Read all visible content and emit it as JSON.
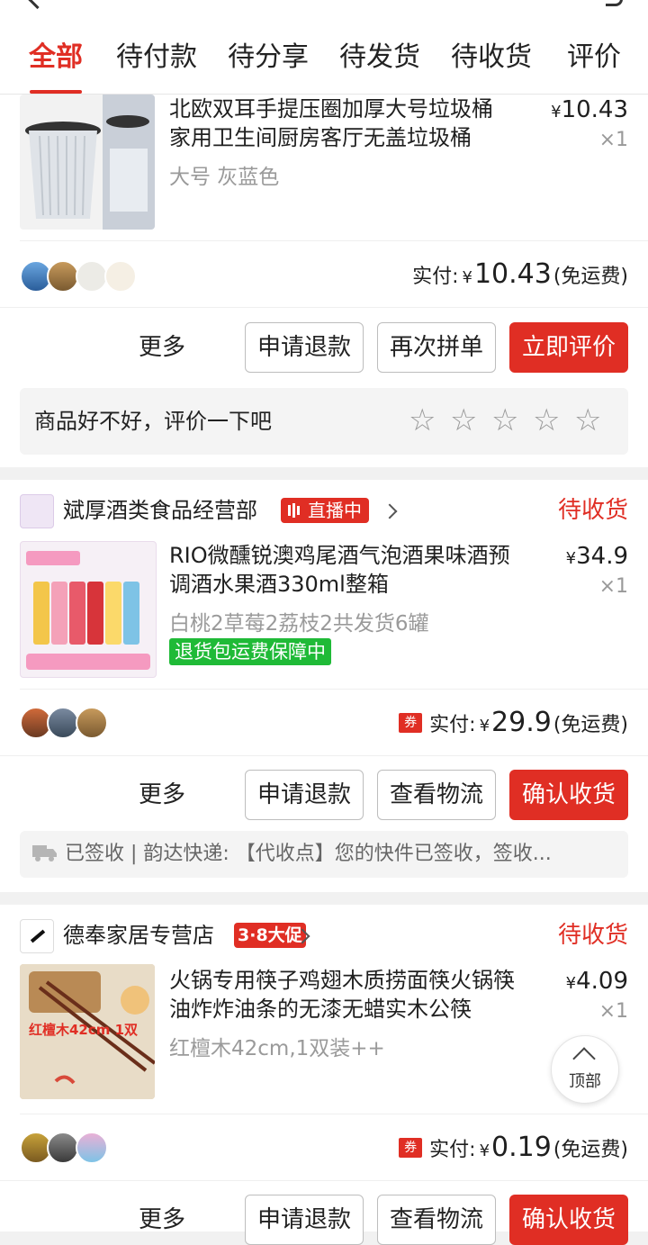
{
  "tabs": [
    "全部",
    "待付款",
    "待分享",
    "待发货",
    "待收货",
    "评价"
  ],
  "order1": {
    "title": "北欧双耳手提压圈加厚大号垃圾桶家用卫生间厨房客厅无盖垃圾桶",
    "title_line1": "北欧双耳手提压圈加厚大号垃圾桶",
    "title_line2": "家用卫生间厨房客厅无盖垃圾桶",
    "price": "10.43",
    "qty": "×1",
    "spec": "大号 灰蓝色",
    "paid_label": "实付:",
    "paid_amount": "10.43",
    "shipping": "(免运费)",
    "more": "更多",
    "buttons": [
      "申请退款",
      "再次拼单",
      "立即评价"
    ],
    "review_prompt": "商品好不好，评价一下吧",
    "stars": 5
  },
  "order2": {
    "shop_name": "斌厚酒类食品经营部",
    "live_badge": "直播中",
    "status": "待收货",
    "title_line1": "RIO微醺锐澳鸡尾酒气泡酒果味酒预",
    "title_line2": "调酒水果酒330ml整箱",
    "price": "34.9",
    "qty": "×1",
    "spec": "白桃2草莓2荔枝2共发货6罐",
    "tag": "退货包运费保障中",
    "coupon": "券",
    "paid_label": "实付:",
    "paid_amount": "29.9",
    "shipping": "(免运费)",
    "more": "更多",
    "buttons": [
      "申请退款",
      "查看物流",
      "确认收货"
    ],
    "logistics": "已签收 | 韵达快递: 【代收点】您的快件已签收，签收..."
  },
  "order3": {
    "shop_name": "德奉家居专营店",
    "promo_badge": "3·8大促",
    "status": "待收货",
    "title_line1": "火锅专用筷子鸡翅木质捞面筷火锅筷",
    "title_line2": "油炸炸油条的无漆无蜡实木公筷",
    "price": "4.09",
    "qty": "×1",
    "spec": "红檀木42cm,1双装++",
    "thumb_caption": "红檀木42cm  1双",
    "coupon": "券",
    "paid_label": "实付:",
    "paid_amount": "0.19",
    "shipping": "(免运费)",
    "more": "更多",
    "buttons": [
      "申请退款",
      "查看物流",
      "确认收货"
    ]
  },
  "back_to_top": "顶部",
  "colors": {
    "accent": "#e02e24",
    "green_tag": "#1fba37"
  }
}
